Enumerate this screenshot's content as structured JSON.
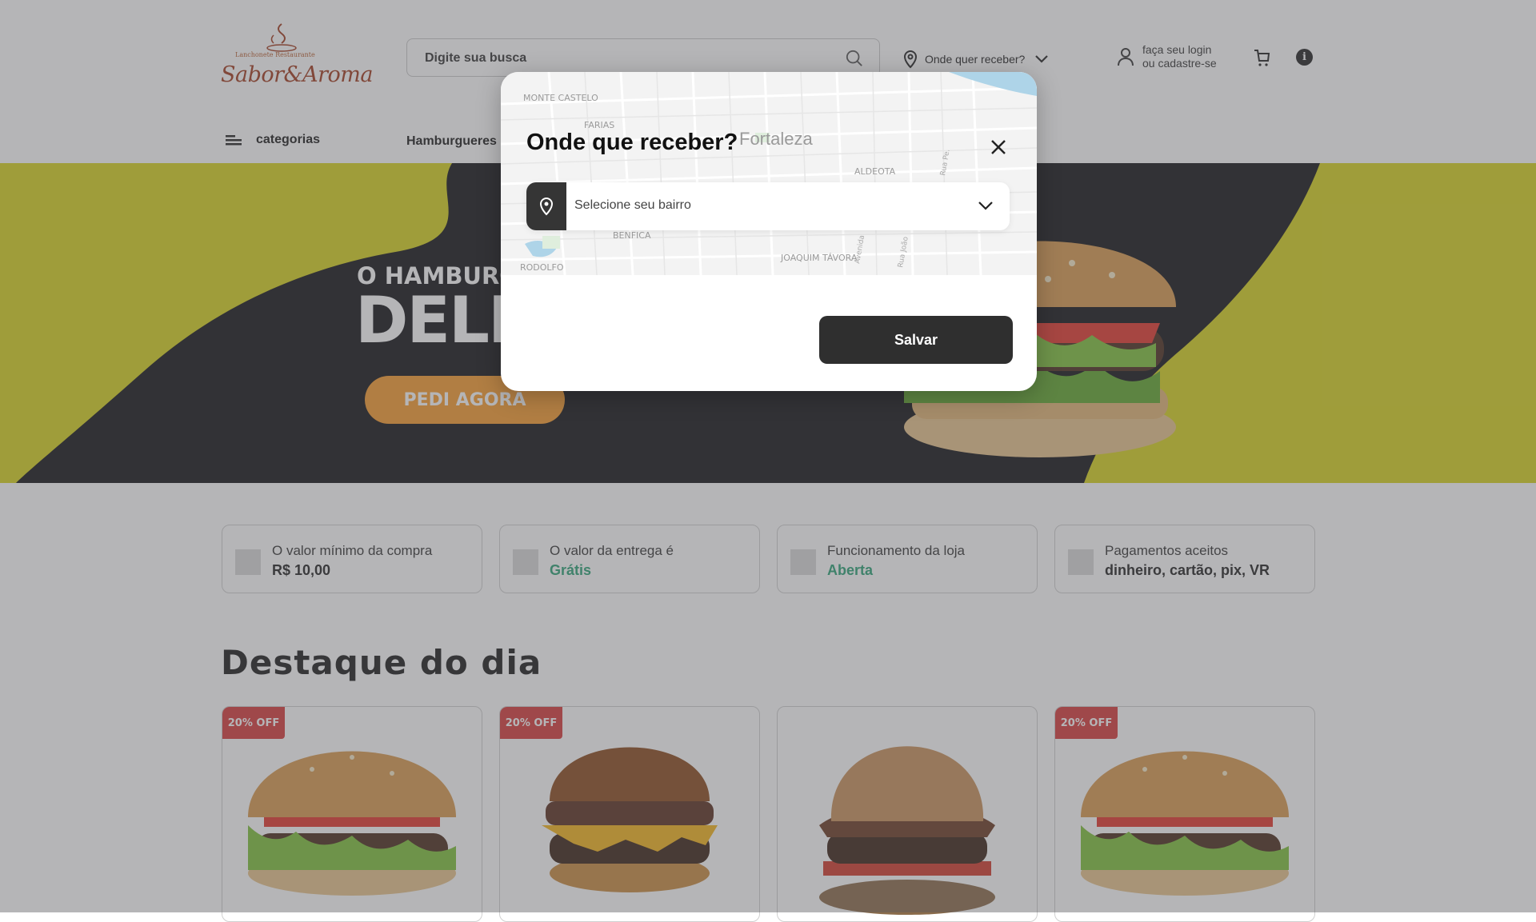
{
  "header": {
    "logo": {
      "small_text": "Lanchonete  Restaurante",
      "big_text": "Sabor&Aroma"
    },
    "search": {
      "placeholder": "Digite sua busca"
    },
    "location_label": "Onde quer receber?",
    "login": {
      "line1": "faça seu login",
      "line2": "ou cadastre-se"
    },
    "icons": [
      "search-icon",
      "map-pin-icon",
      "chevron-down-icon",
      "user-icon",
      "cart-icon",
      "info-icon",
      "menu-icon"
    ]
  },
  "nav": {
    "categories_label": "categorias",
    "item1": "Hamburgueres"
  },
  "hero": {
    "line1": "O HAMBURGUER MAIS",
    "line2": "DELICIOSO",
    "cta": "PEDI AGORA",
    "colors": {
      "yellow": "#d8d31c",
      "dark": "#111215",
      "orange": "#f79b2c"
    }
  },
  "info_cards": [
    {
      "label": "O valor mínimo da compra",
      "value": "R$ 10,00"
    },
    {
      "label": "O valor da entrega é",
      "value": "Grátis"
    },
    {
      "label": "Funcionamento da loja",
      "value": "Aberta"
    },
    {
      "label": "Pagamentos aceitos",
      "value": "dinheiro, cartão, pix, VR"
    }
  ],
  "featured": {
    "title": "Destaque do dia",
    "badges": [
      "20% OFF",
      "20% OFF",
      "",
      "20% OFF"
    ]
  },
  "modal": {
    "title": "Onde que receber?",
    "city": "Fortaleza",
    "select_placeholder": "Selecione seu bairro",
    "save_label": "Salvar",
    "map_labels": [
      "MONTE CASTELO",
      "FARIAS",
      "BENFICA",
      "RODOLFO",
      "ALDEOTA",
      "JOAQUIM TÁVORA",
      "Avenida",
      "Rua João",
      "Rua Pe."
    ]
  }
}
